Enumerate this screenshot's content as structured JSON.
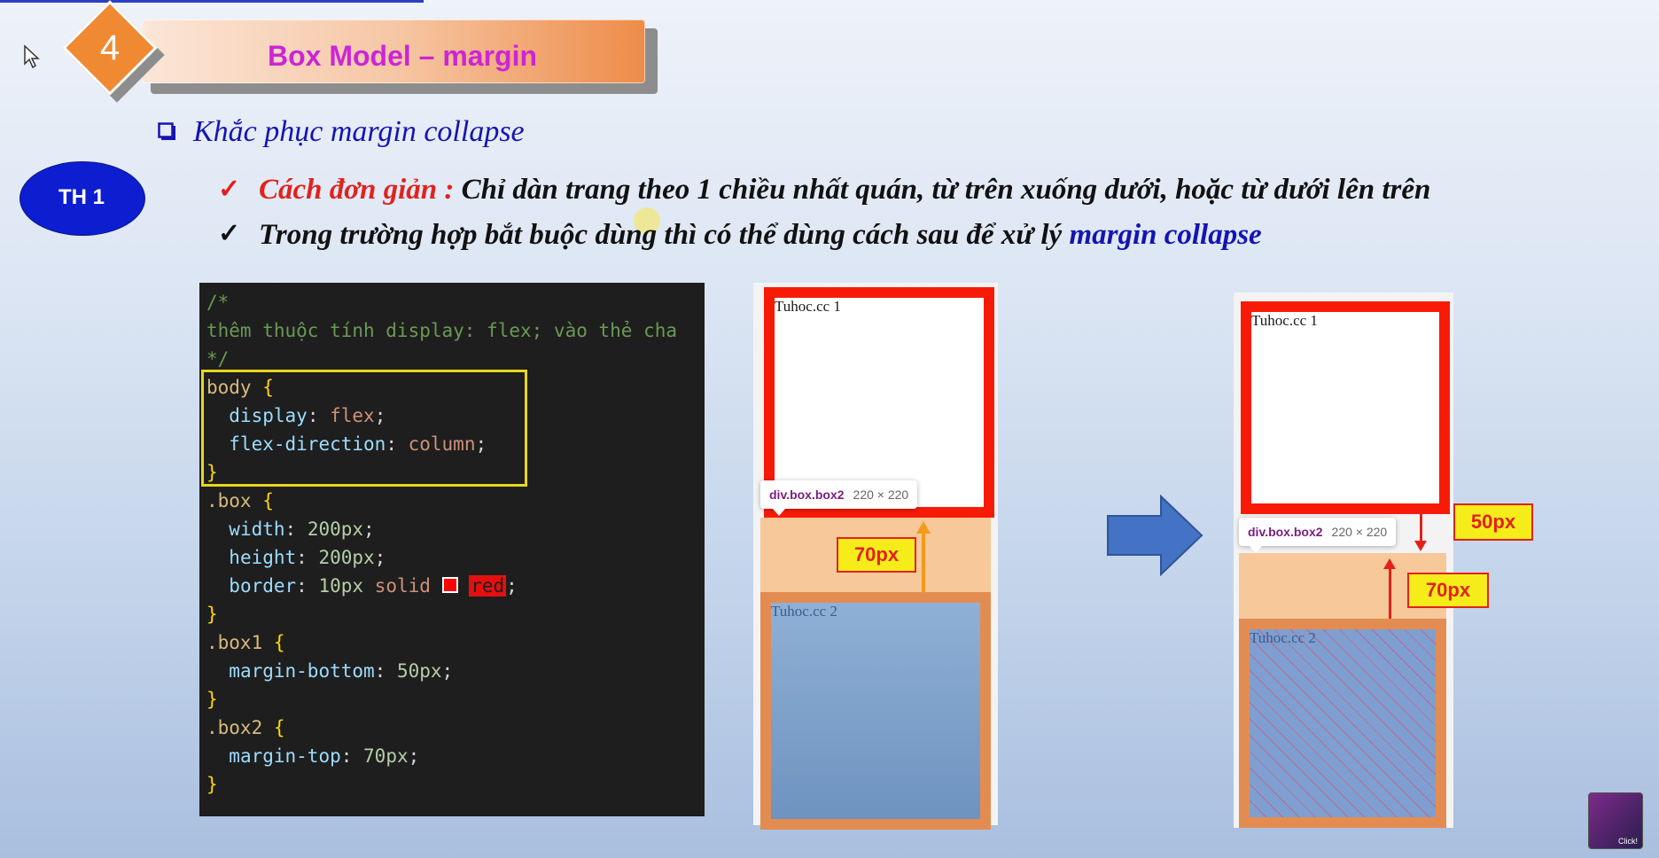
{
  "slide": {
    "number": "4",
    "title": "Box Model – margin",
    "heading": "Khắc phục margin collapse",
    "badge": "TH 1",
    "bullets": {
      "b1_label": "Cách đơn giản :",
      "b1_text": "Chỉ dàn trang theo 1 chiều nhất quán, từ trên xuống dưới, hoặc từ dưới lên trên",
      "b2_text": "Trong trường hợp bắt buộc dùng thì có thể dùng cách sau để xử lý",
      "b2_highlight": "margin collapse"
    },
    "colors": {
      "accent_orange": "#ef8a32",
      "title_magenta": "#cc25d6",
      "heading_blue": "#1414b4",
      "badge_blue": "#0c1ed0",
      "red": "#e0231d"
    }
  },
  "code": {
    "comment_open": "/*",
    "comment_text": "thêm thuộc tính display: flex; vào thẻ cha",
    "comment_close": "*/",
    "body_sel": "body",
    "open_brace": "{",
    "close_brace": "}",
    "display_prop": "display",
    "display_val": "flex",
    "fd_prop": "flex-direction",
    "fd_val": "column",
    "box_sel": ".box",
    "width_prop": "width",
    "width_val": "200px",
    "height_prop": "height",
    "height_val": "200px",
    "border_prop": "border",
    "border_val1": "10px",
    "border_val2": "solid",
    "border_val3": "red",
    "box1_sel": ".box1",
    "mb_prop": "margin-bottom",
    "mb_val": "50px",
    "box2_sel": ".box2",
    "mt_prop": "margin-top",
    "mt_val": "70px"
  },
  "demo_before": {
    "box1_label": "Tuhoc.cc 1",
    "box2_label": "Tuhoc.cc 2",
    "tooltip_name": "div.box.box2",
    "tooltip_size": "220 × 220",
    "margin_label": "70px"
  },
  "demo_after": {
    "box1_label": "Tuhoc.cc 1",
    "box2_label": "Tuhoc.cc 2",
    "tooltip_name": "div.box.box2",
    "tooltip_size": "220 × 220",
    "margin_bottom_label": "50px",
    "margin_top_label": "70px"
  },
  "icons": [
    "cursor-icon",
    "checkbox-square-icon",
    "checkmark-icon",
    "right-arrow-icon",
    "channel-logo-icon"
  ],
  "channel": {
    "label": "Click!"
  }
}
